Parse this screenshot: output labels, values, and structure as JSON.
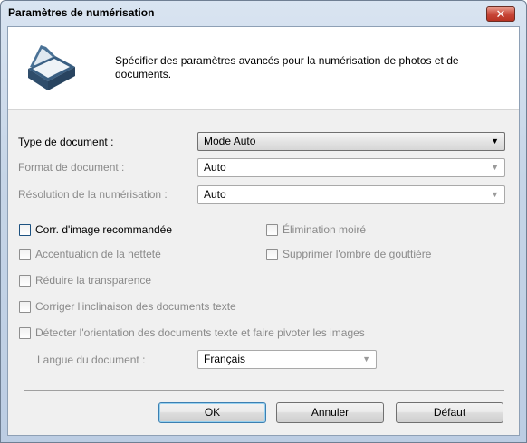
{
  "window": {
    "title": "Paramètres de numérisation",
    "close_glyph": "✕"
  },
  "header": {
    "icon": "scanner-icon",
    "description": "Spécifier des paramètres avancés pour la numérisation de photos et de documents."
  },
  "settings": {
    "document_type": {
      "label": "Type de document :",
      "value": "Mode Auto"
    },
    "document_format": {
      "label": "Format de document :",
      "value": "Auto"
    },
    "scan_resolution": {
      "label": "Résolution de la numérisation :",
      "value": "Auto"
    }
  },
  "options": {
    "image_correction": {
      "label": "Corr. d'image recommandée",
      "checked": false
    },
    "moire_removal": {
      "label": "Élimination moiré",
      "checked": false
    },
    "sharpening": {
      "label": "Accentuation de la netteté",
      "checked": false
    },
    "gutter_shadow": {
      "label": "Supprimer l'ombre de gouttière",
      "checked": false
    },
    "reduce_show_through": {
      "label": "Réduire la transparence",
      "checked": false
    },
    "deskew": {
      "label": "Corriger l'inclinaison des documents texte",
      "checked": false
    },
    "orientation": {
      "label": "Détecter l'orientation des documents texte et faire pivoter les images",
      "checked": false
    }
  },
  "language": {
    "label": "Langue du document :",
    "value": "Français"
  },
  "buttons": {
    "ok": "OK",
    "cancel": "Annuler",
    "default": "Défaut"
  },
  "dropdown_glyph": "▼"
}
